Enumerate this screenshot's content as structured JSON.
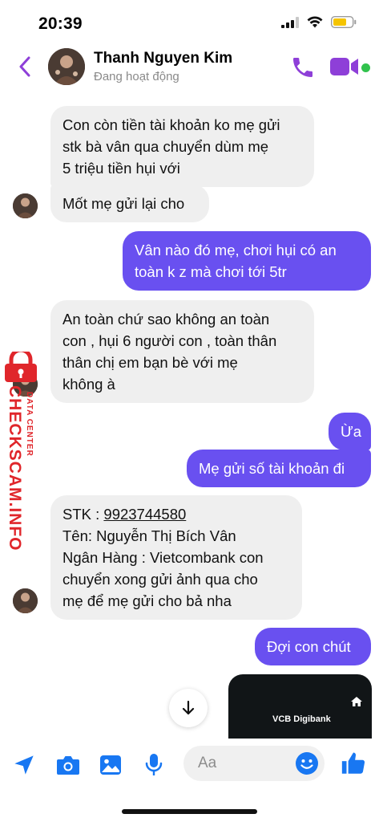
{
  "status_bar": {
    "time": "20:39",
    "icons": [
      "signal-icon",
      "wifi-icon",
      "battery-icon"
    ]
  },
  "header": {
    "contact_name": "Thanh Nguyen Kim",
    "contact_status": "Đang hoạt động",
    "accent_color": "#8e3fd8",
    "online_color": "#31c24d",
    "icons": [
      "back-arrow-icon",
      "phone-icon",
      "video-camera-icon"
    ]
  },
  "messages": [
    {
      "direction": "incoming",
      "lines": [
        "Con còn tiền tài khoản ko mẹ gửi",
        "stk bà vân qua chuyển dùm mẹ",
        "5 triệu tiền hụi với"
      ]
    },
    {
      "direction": "incoming",
      "lines": [
        "Mốt mẹ gửi lại cho"
      ]
    },
    {
      "direction": "outgoing",
      "lines": [
        "Vân nào đó mẹ, chơi hụi có an",
        "toàn k z mà chơi tới 5tr"
      ]
    },
    {
      "direction": "incoming",
      "lines": [
        "An toàn chứ sao không an toàn",
        "con , hụi 6 người con , toàn thân",
        "thân chị em bạn bè với mẹ",
        "không à"
      ]
    },
    {
      "direction": "outgoing",
      "lines": [
        "Ừa"
      ]
    },
    {
      "direction": "outgoing",
      "lines": [
        "Mẹ gửi số tài khoản đi"
      ]
    },
    {
      "direction": "incoming",
      "lines": [
        "STK : ",
        "Tên: Nguyễn Thị Bích Vân",
        "Ngân Hàng : Vietcombank con",
        "chuyển xong gửi ảnh qua cho",
        "mẹ để mẹ gửi cho bả nha"
      ],
      "account_number": "9923744580"
    },
    {
      "direction": "outgoing",
      "lines": [
        "Đợi con chút"
      ]
    }
  ],
  "image_preview": {
    "brand_text": "VCB Digibank"
  },
  "watermark": {
    "text": "CHECKSCAM.INFO",
    "subtext": "DATA CENTER",
    "color": "#e0262b"
  },
  "composer": {
    "placeholder": "Aa",
    "icons": [
      "send-location-icon",
      "camera-icon",
      "gallery-icon",
      "microphone-icon",
      "emoji-icon",
      "thumbs-up-icon"
    ]
  },
  "colors": {
    "outgoing_bubble": "#6950f0",
    "incoming_bubble": "#efefef",
    "messenger_blue": "#1877f2"
  }
}
